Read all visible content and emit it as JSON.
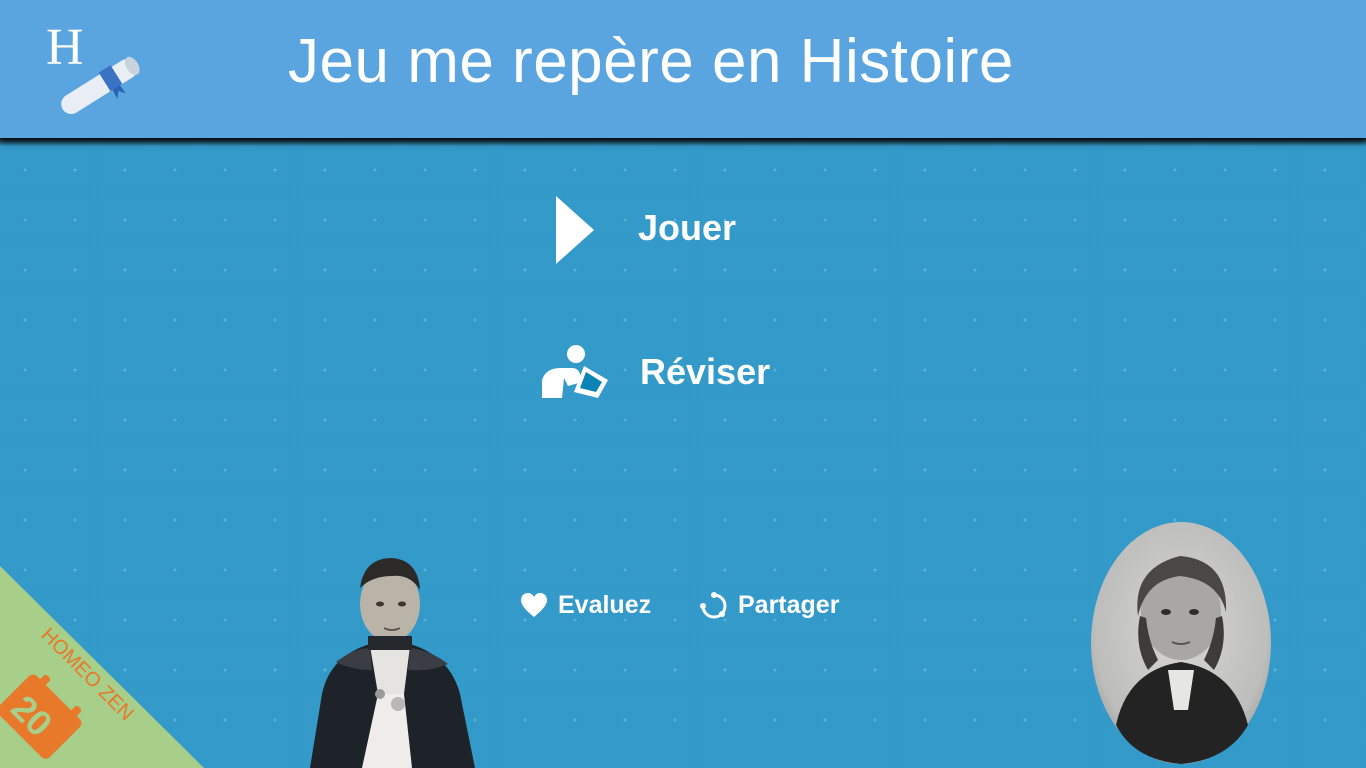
{
  "header": {
    "title": "Jeu me repère en Histoire",
    "logo_icon": "history-diploma-logo-icon"
  },
  "menu": {
    "play_label": "Jouer",
    "play_icon": "play-triangle-icon",
    "review_label": "Réviser",
    "review_icon": "reading-person-icon"
  },
  "links": {
    "rate_label": "Evaluez",
    "rate_icon": "heart-icon",
    "share_label": "Partager",
    "share_icon": "share-circle-icon"
  },
  "badge": {
    "text": "HOMEO ZEN"
  },
  "colors": {
    "header": "#5aa4df",
    "background": "#0a83b5",
    "text": "#ffffff",
    "badge_green": "#a7cf8a",
    "badge_orange": "#e8782a"
  }
}
